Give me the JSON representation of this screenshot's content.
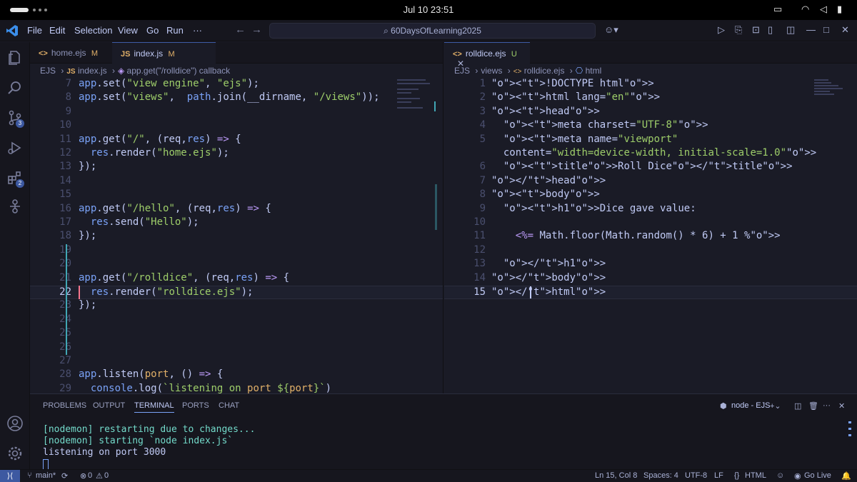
{
  "system": {
    "clock": "Jul 10  23:51"
  },
  "menu": [
    "File",
    "Edit",
    "Selection",
    "View",
    "Go",
    "Run",
    "···"
  ],
  "search": {
    "text": "60DaysOfLearning2025"
  },
  "badges": {
    "source_control": "3",
    "extensions": "2"
  },
  "left_editor": {
    "tabs": [
      {
        "icon": "<>",
        "name": "home.ejs",
        "state": "M"
      },
      {
        "icon": "JS",
        "name": "index.js",
        "state": "M"
      }
    ],
    "breadcrumb": [
      "EJS",
      "index.js",
      "app.get(\"/rolldice\") callback"
    ],
    "lines": [
      {
        "n": "7",
        "text": "app.set(\"view engine\", \"ejs\");"
      },
      {
        "n": "8",
        "text": "app.set(\"views\",  path.join(__dirname, \"/views\"));"
      },
      {
        "n": "9",
        "text": ""
      },
      {
        "n": "10",
        "text": ""
      },
      {
        "n": "11",
        "text": "app.get(\"/\", (req,res) => {"
      },
      {
        "n": "12",
        "text": "  res.render(\"home.ejs\");"
      },
      {
        "n": "13",
        "text": "});"
      },
      {
        "n": "14",
        "text": ""
      },
      {
        "n": "15",
        "text": ""
      },
      {
        "n": "16",
        "text": "app.get(\"/hello\", (req,res) => {"
      },
      {
        "n": "17",
        "text": "  res.send(\"Hello\");"
      },
      {
        "n": "18",
        "text": "});"
      },
      {
        "n": "19",
        "text": ""
      },
      {
        "n": "20",
        "text": ""
      },
      {
        "n": "21",
        "text": "app.get(\"/rolldice\", (req,res) => {"
      },
      {
        "n": "22",
        "text": "  res.render(\"rolldice.ejs\");"
      },
      {
        "n": "23",
        "text": "});"
      },
      {
        "n": "24",
        "text": ""
      },
      {
        "n": "25",
        "text": ""
      },
      {
        "n": "26",
        "text": ""
      },
      {
        "n": "27",
        "text": ""
      },
      {
        "n": "28",
        "text": "app.listen(port, () => {"
      },
      {
        "n": "29",
        "text": "  console.log(`listening on port ${port}`)"
      }
    ]
  },
  "right_editor": {
    "tabs": [
      {
        "icon": "<>",
        "name": "rolldice.ejs",
        "state": "U"
      }
    ],
    "breadcrumb": [
      "EJS",
      "views",
      "rolldice.ejs",
      "html"
    ],
    "lines": [
      {
        "n": "1",
        "text": "<!DOCTYPE html>"
      },
      {
        "n": "2",
        "text": "<html lang=\"en\">"
      },
      {
        "n": "3",
        "text": "<head>"
      },
      {
        "n": "4",
        "text": "  <meta charset=\"UTF-8\">"
      },
      {
        "n": "5",
        "text": "  <meta name=\"viewport\""
      },
      {
        "n": "",
        "text": "  content=\"width=device-width, initial-scale=1.0\">"
      },
      {
        "n": "6",
        "text": "  <title>Roll Dice</title>"
      },
      {
        "n": "7",
        "text": "</head>"
      },
      {
        "n": "8",
        "text": "<body>"
      },
      {
        "n": "9",
        "text": "  <h1>Dice gave value:"
      },
      {
        "n": "10",
        "text": ""
      },
      {
        "n": "11",
        "text": "    <%= Math.floor(Math.random() * 6) + 1 %>"
      },
      {
        "n": "12",
        "text": ""
      },
      {
        "n": "13",
        "text": "  </h1>"
      },
      {
        "n": "14",
        "text": "</body>"
      },
      {
        "n": "15",
        "text": "</html>"
      }
    ]
  },
  "panel": {
    "tabs": [
      "PROBLEMS",
      "OUTPUT",
      "TERMINAL",
      "PORTS",
      "CHAT"
    ],
    "active_tab": "TERMINAL",
    "terminal_name": "node - EJS",
    "terminal_lines": [
      "[nodemon] restarting due to changes...",
      "[nodemon] starting `node index.js`",
      "listening on port 3000"
    ]
  },
  "status": {
    "branch": "main*",
    "problems": "0",
    "warnings": "0",
    "cursor": "Ln 15, Col 8",
    "spaces": "Spaces: 4",
    "encoding": "UTF-8",
    "eol": "LF",
    "language": "HTML",
    "live": "Go Live"
  },
  "colors": {
    "background": "#1a1b26",
    "chrome": "#16161e",
    "accent": "#3d59a1",
    "keyword": "#7aa2f7",
    "string": "#9ece6a",
    "param": "#e0af68",
    "tag": "#f7768e",
    "terminal_green": "#73daca"
  }
}
